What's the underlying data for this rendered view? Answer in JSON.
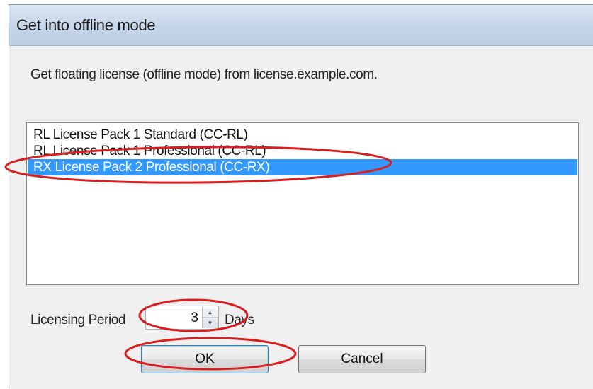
{
  "dialog": {
    "title": "Get into offline mode",
    "description": "Get floating license (offline mode) from license.example.com."
  },
  "license_list": {
    "items": [
      {
        "label": "RL License Pack 1 Standard (CC-RL)",
        "selected": false
      },
      {
        "label": "RL License Pack 1 Professional (CC-RL)",
        "selected": false
      },
      {
        "label": "RX License Pack 2 Professional (CC-RX)",
        "selected": true
      }
    ]
  },
  "licensing_period": {
    "label_prefix": "Licensing ",
    "label_accel": "P",
    "label_suffix": "eriod",
    "value": "3",
    "unit": "Days"
  },
  "buttons": {
    "ok_accel": "O",
    "ok_rest": "K",
    "cancel_accel": "C",
    "cancel_rest": "ancel"
  },
  "colors": {
    "selection": "#3399ff",
    "annotation": "#d81e1e"
  }
}
